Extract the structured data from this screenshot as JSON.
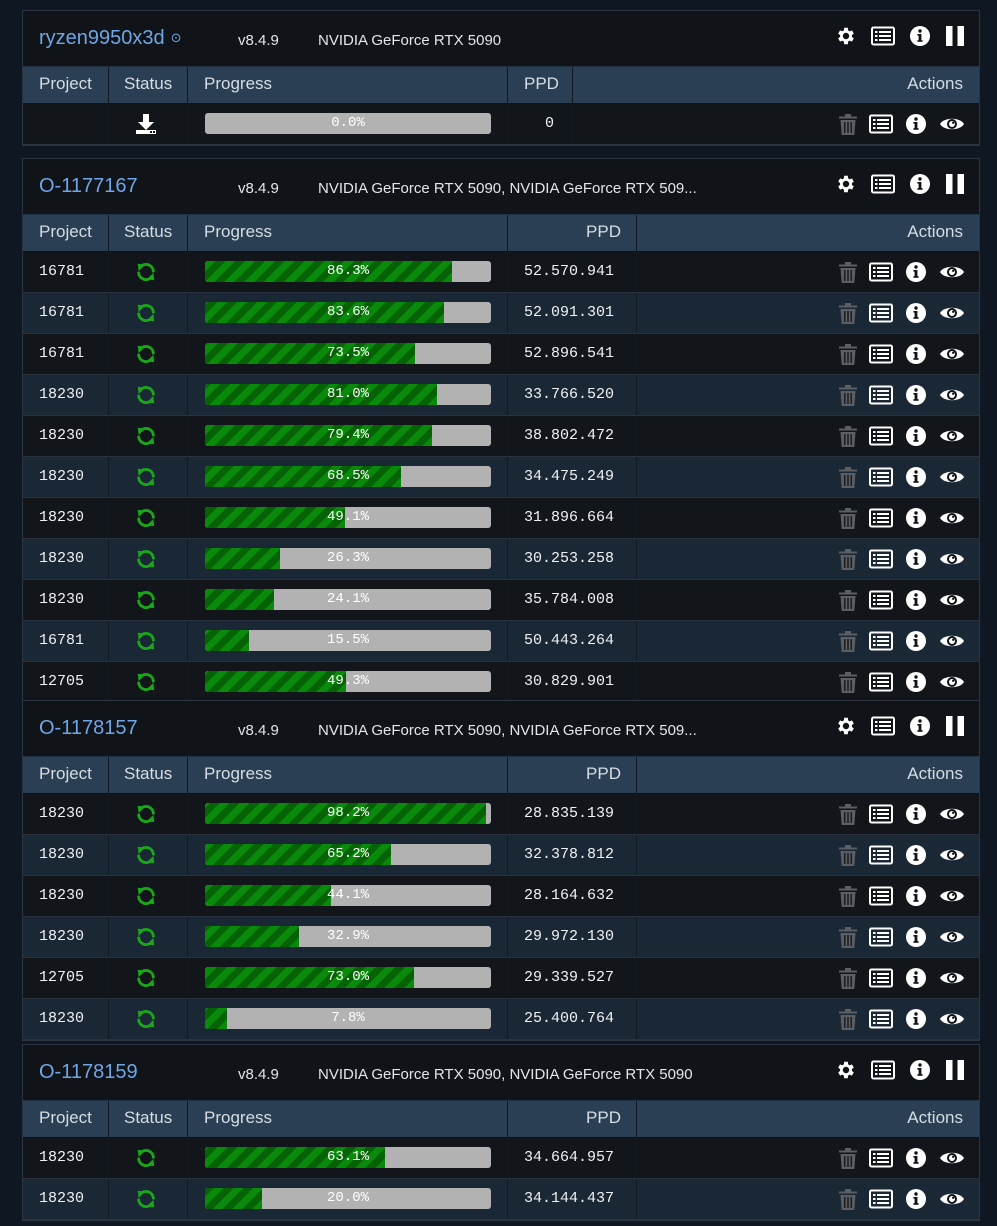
{
  "columns": {
    "project": "Project",
    "status": "Status",
    "progress": "Progress",
    "ppd": "PPD",
    "actions": "Actions"
  },
  "colors": {
    "machine_name": "#6fa6e6",
    "progress_fill": "#0a8a0a",
    "progress_track": "#b2b2b2",
    "status_running": "#1aa51a",
    "header_bar": "#2a3f53"
  },
  "icons": {
    "machine_actions": [
      "gear-icon",
      "list-icon",
      "info-icon",
      "pause-icon"
    ],
    "row_actions": [
      "trash-icon",
      "list-icon",
      "info-icon",
      "eye-icon"
    ],
    "status_running": "refresh-icon",
    "status_download": "download-icon",
    "online_indicator": "target-dot-icon"
  },
  "machines": [
    {
      "name": "ryzen9950x3d",
      "online_dot": "⊙",
      "version": "v8.4.9",
      "gpu": "NVIDIA GeForce RTX 5090",
      "rows": [
        {
          "project": "",
          "status": "download",
          "progress": 0.0,
          "progress_text": "0.0%",
          "ppd": "0"
        }
      ]
    },
    {
      "name": "O-1177167",
      "online_dot": "",
      "version": "v8.4.9",
      "gpu": "NVIDIA GeForce RTX 5090, NVIDIA GeForce RTX 509...",
      "rows": [
        {
          "project": "16781",
          "status": "running",
          "progress": 86.3,
          "progress_text": "86.3%",
          "ppd": "52.570.941"
        },
        {
          "project": "16781",
          "status": "running",
          "progress": 83.6,
          "progress_text": "83.6%",
          "ppd": "52.091.301"
        },
        {
          "project": "16781",
          "status": "running",
          "progress": 73.5,
          "progress_text": "73.5%",
          "ppd": "52.896.541"
        },
        {
          "project": "18230",
          "status": "running",
          "progress": 81.0,
          "progress_text": "81.0%",
          "ppd": "33.766.520"
        },
        {
          "project": "18230",
          "status": "running",
          "progress": 79.4,
          "progress_text": "79.4%",
          "ppd": "38.802.472"
        },
        {
          "project": "18230",
          "status": "running",
          "progress": 68.5,
          "progress_text": "68.5%",
          "ppd": "34.475.249"
        },
        {
          "project": "18230",
          "status": "running",
          "progress": 49.1,
          "progress_text": "49.1%",
          "ppd": "31.896.664"
        },
        {
          "project": "18230",
          "status": "running",
          "progress": 26.3,
          "progress_text": "26.3%",
          "ppd": "30.253.258"
        },
        {
          "project": "18230",
          "status": "running",
          "progress": 24.1,
          "progress_text": "24.1%",
          "ppd": "35.784.008"
        },
        {
          "project": "16781",
          "status": "running",
          "progress": 15.5,
          "progress_text": "15.5%",
          "ppd": "50.443.264"
        },
        {
          "project": "12705",
          "status": "running",
          "progress": 49.3,
          "progress_text": "49.3%",
          "ppd": "30.829.901"
        }
      ]
    },
    {
      "name": "O-1178157",
      "online_dot": "",
      "version": "v8.4.9",
      "gpu": "NVIDIA GeForce RTX 5090, NVIDIA GeForce RTX 509...",
      "rows": [
        {
          "project": "18230",
          "status": "running",
          "progress": 98.2,
          "progress_text": "98.2%",
          "ppd": "28.835.139"
        },
        {
          "project": "18230",
          "status": "running",
          "progress": 65.2,
          "progress_text": "65.2%",
          "ppd": "32.378.812"
        },
        {
          "project": "18230",
          "status": "running",
          "progress": 44.1,
          "progress_text": "44.1%",
          "ppd": "28.164.632"
        },
        {
          "project": "18230",
          "status": "running",
          "progress": 32.9,
          "progress_text": "32.9%",
          "ppd": "29.972.130"
        },
        {
          "project": "12705",
          "status": "running",
          "progress": 73.0,
          "progress_text": "73.0%",
          "ppd": "29.339.527"
        },
        {
          "project": "18230",
          "status": "running",
          "progress": 7.8,
          "progress_text": "7.8%",
          "ppd": "25.400.764"
        }
      ]
    },
    {
      "name": "O-1178159",
      "online_dot": "",
      "version": "v8.4.9",
      "gpu": "NVIDIA GeForce RTX 5090, NVIDIA GeForce RTX 5090",
      "rows": [
        {
          "project": "18230",
          "status": "running",
          "progress": 63.1,
          "progress_text": "63.1%",
          "ppd": "34.664.957"
        },
        {
          "project": "18230",
          "status": "running",
          "progress": 20.0,
          "progress_text": "20.0%",
          "ppd": "34.144.437"
        }
      ]
    }
  ]
}
